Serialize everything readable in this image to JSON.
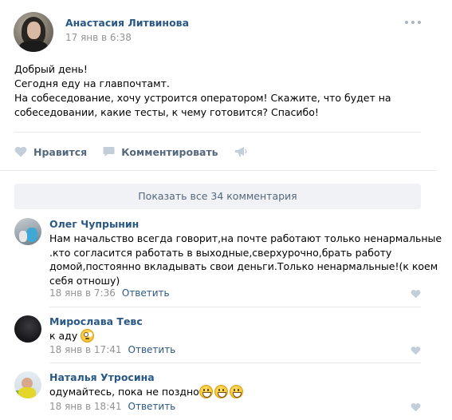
{
  "post": {
    "author": "Анастасия Литвинова",
    "date": "17 янв в 6:38",
    "text_lines": [
      "Добрый день!",
      "Сегодня еду на главпочтамт.",
      "На собеседование, хочу устроится оператором! Скажите, что будет на",
      "собеседовании, какие тесты, к чему готовится? Спасибо!"
    ],
    "actions": {
      "like_label": "Нравится",
      "comment_label": "Комментировать"
    }
  },
  "show_all_label": "Показать все 34 комментария",
  "comments": [
    {
      "author": "Олег Чупрынин",
      "text_lines": [
        "Нам начальство всегда говорит,на почте работают только ненармальные",
        ".кто согласится работать в выходные,сверхурочно,брать работу",
        "домой,постоянно вкладывать свои деньги.Только ненармальные!(к коем",
        "себя отношу)"
      ],
      "date": "18 янв в 7:36",
      "reply_label": "Ответить"
    },
    {
      "author": "Мирослава Тевс",
      "text": "к аду",
      "date": "18 янв в 17:41",
      "reply_label": "Ответить"
    },
    {
      "author": "Наталья Утросина",
      "text": "одумайтесь, пока не поздно",
      "date": "18 янв в 18:41",
      "reply_label": "Ответить"
    }
  ],
  "colors": {
    "link": "#2a5885",
    "meta": "#939393",
    "action": "#55677d",
    "button_bg": "#f0f2f5",
    "divider": "#e7e8ec",
    "heart": "#c3cedb"
  },
  "icons": {
    "more": "more-icon",
    "like": "heart-icon",
    "comment": "comment-icon",
    "share": "megaphone-icon",
    "emoji_roll": "eye-roll-emoji-icon",
    "emoji_grin": "grinning-emoji-icon"
  }
}
